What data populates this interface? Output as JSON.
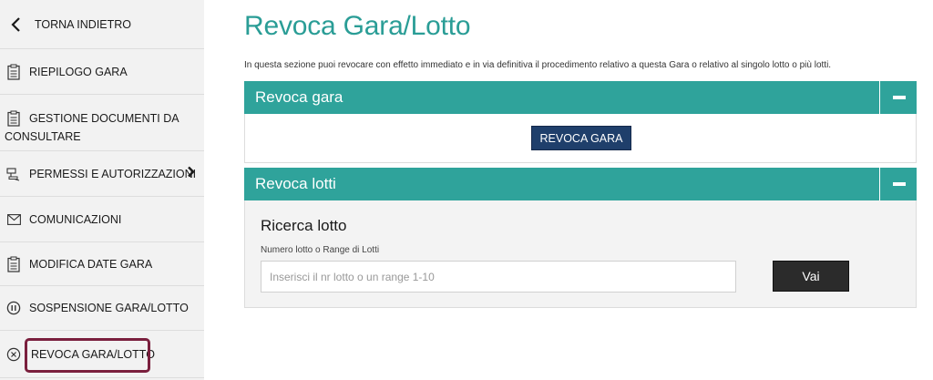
{
  "sidebar": {
    "back": {
      "label": "TORNA INDIETRO",
      "icon": "chevron-left-icon"
    },
    "items": [
      {
        "label": "RIEPILOGO GARA",
        "icon": "clipboard-icon"
      },
      {
        "label_line1": "GESTIONE DOCUMENTI DA",
        "label_line2": "CONSULTARE",
        "icon": "clipboard-icon"
      },
      {
        "label": "PERMESSI E AUTORIZZAZIONI",
        "icon": "stamp-icon",
        "has_submenu": true
      },
      {
        "label": "COMUNICAZIONI",
        "icon": "envelope-icon"
      },
      {
        "label": "MODIFICA DATE GARA",
        "icon": "clipboard-icon"
      },
      {
        "label": "SOSPENSIONE GARA/LOTTO",
        "icon": "pause-icon"
      },
      {
        "label": "REVOCA GARA/LOTTO",
        "icon": "cancel-icon",
        "active": true
      }
    ]
  },
  "main": {
    "title": "Revoca Gara/Lotto",
    "intro": "In questa sezione puoi revocare con effetto immediato e in via definitiva il procedimento relativo a questa Gara o relativo al singolo lotto o più lotti.",
    "panel_gara": {
      "header": "Revoca gara",
      "button": "REVOCA GARA"
    },
    "panel_lotti": {
      "header": "Revoca lotti",
      "search_title": "Ricerca lotto",
      "field_label": "Numero lotto o Range di Lotti",
      "placeholder": "Inserisci il nr lotto o un range 1-10",
      "value": "",
      "button": "Vai"
    }
  },
  "colors": {
    "accent": "#2fa39b",
    "title": "#2a9d96",
    "primary_button": "#1f3f6b",
    "dark_button": "#2b2b2b",
    "active_outline": "#7a1f3d"
  }
}
